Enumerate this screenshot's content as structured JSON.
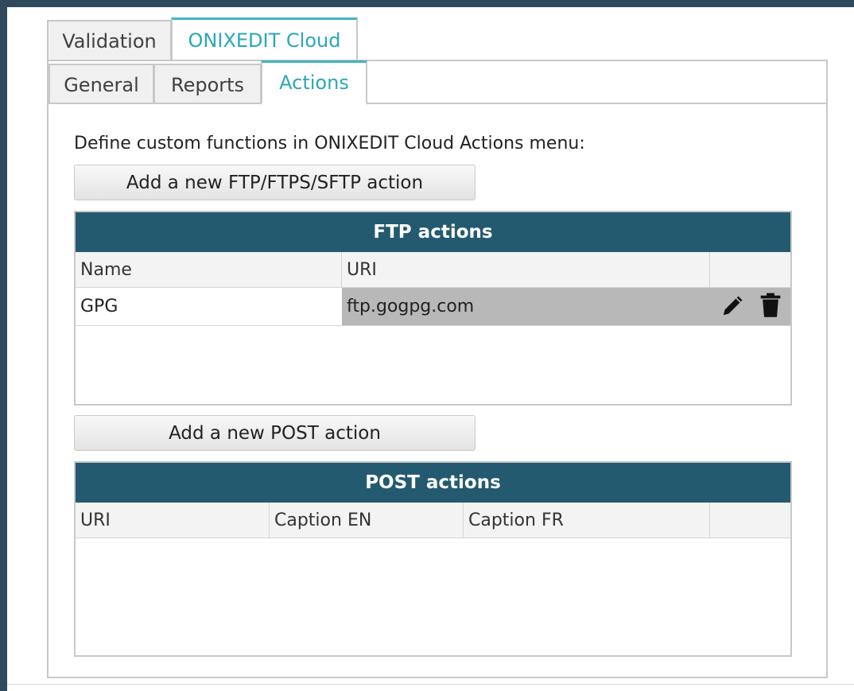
{
  "tabs_top": [
    {
      "label": "Validation",
      "active": false
    },
    {
      "label": "ONIXEDIT Cloud",
      "active": true
    }
  ],
  "tabs_sub": [
    {
      "label": "General",
      "active": false
    },
    {
      "label": "Reports",
      "active": false
    },
    {
      "label": "Actions",
      "active": true
    }
  ],
  "intro_text": "Define custom functions in ONIXEDIT Cloud Actions menu:",
  "ftp": {
    "add_button_label": "Add a new FTP/FTPS/SFTP action",
    "title": "FTP actions",
    "columns": [
      "Name",
      "URI"
    ],
    "rows": [
      {
        "name": "GPG",
        "uri": "ftp.gogpg.com",
        "icons": [
          "edit-pencil-icon",
          "delete-trash-icon"
        ]
      }
    ]
  },
  "post": {
    "add_button_label": "Add a new POST action",
    "title": "POST actions",
    "columns": [
      "URI",
      "Caption EN",
      "Caption FR"
    ],
    "rows": []
  },
  "colors": {
    "accent_tab": "#2aa7b8",
    "grid_title_bg": "#235a70",
    "selected_row_bg": "#b8b8b8"
  }
}
